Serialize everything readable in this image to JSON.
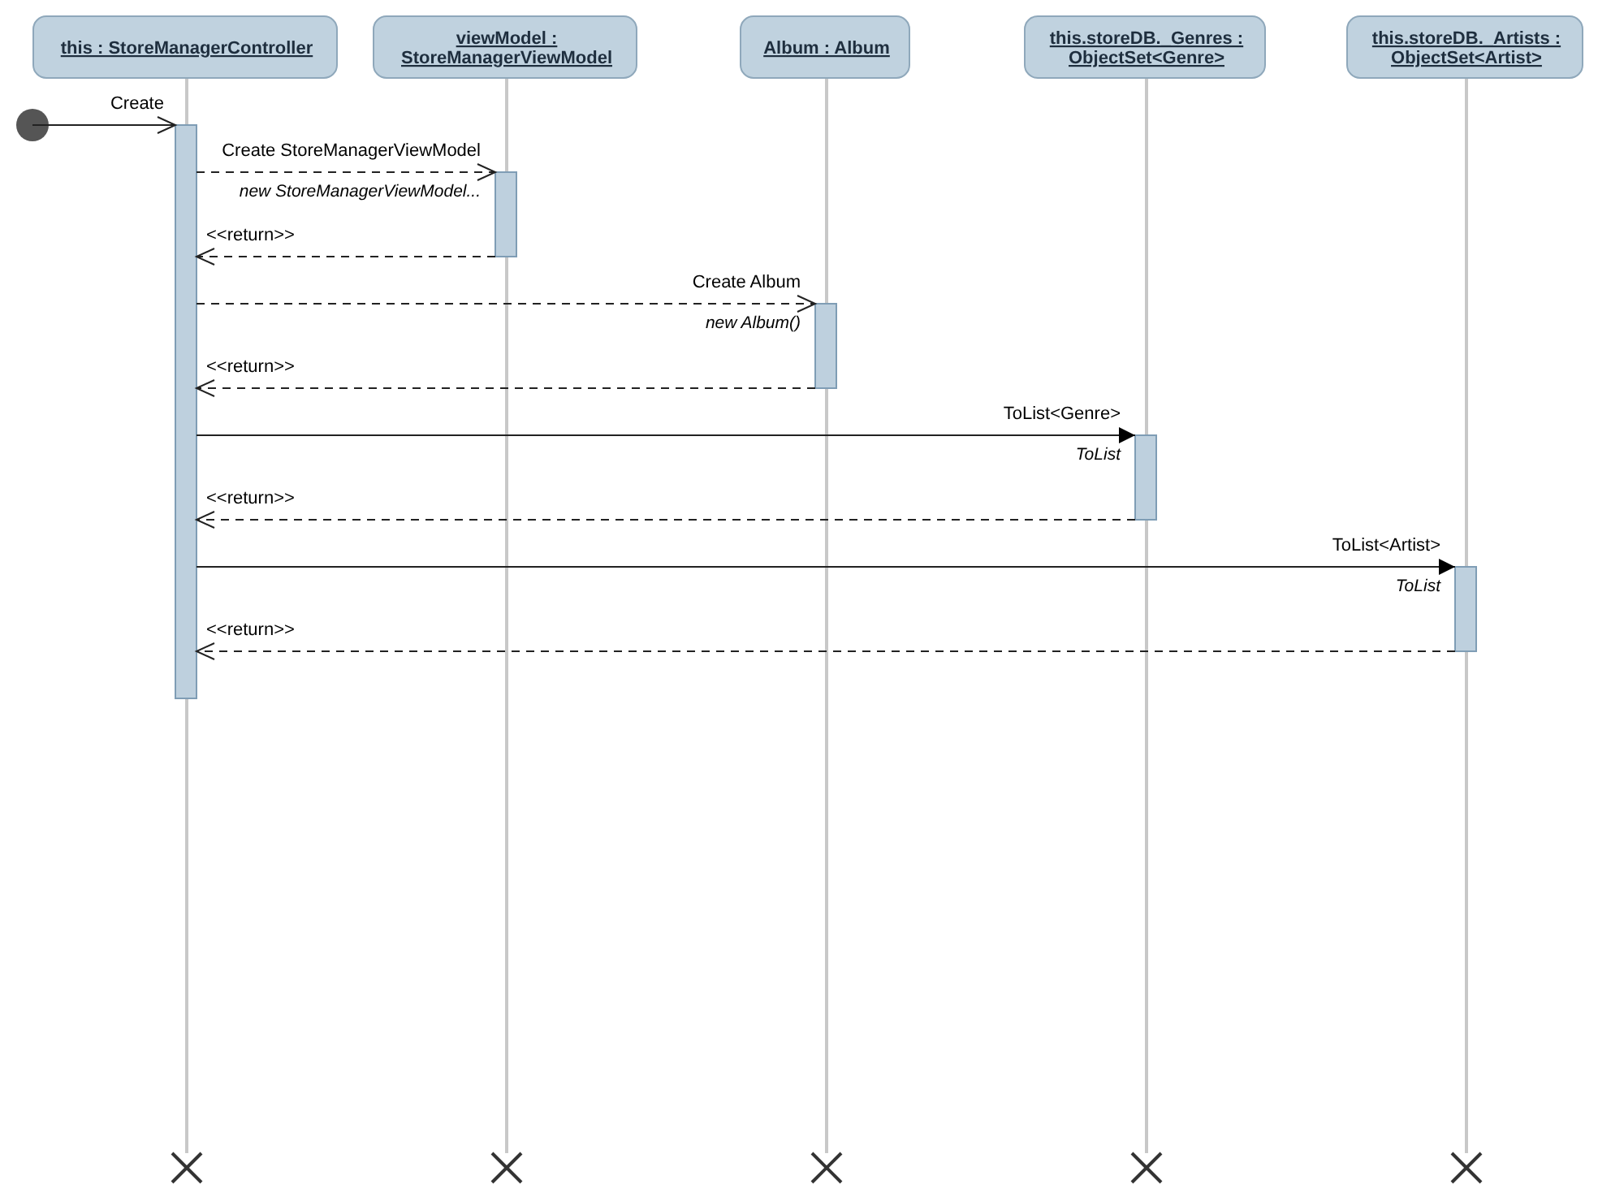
{
  "lifelines": [
    {
      "lines": [
        "this : StoreManagerController"
      ],
      "destroyed": true
    },
    {
      "lines": [
        "viewModel :",
        "StoreManagerViewModel"
      ],
      "destroyed": true
    },
    {
      "lines": [
        "Album : Album"
      ],
      "destroyed": true
    },
    {
      "lines": [
        "this.storeDB._Genres :",
        "ObjectSet<Genre>"
      ],
      "destroyed": true
    },
    {
      "lines": [
        "this.storeDB._Artists :",
        "ObjectSet<Artist>"
      ],
      "destroyed": true
    }
  ],
  "messages": [
    {
      "kind": "found",
      "label": "Create"
    },
    {
      "kind": "create",
      "label": "Create StoreManagerViewModel",
      "note": "new StoreManagerViewModel..."
    },
    {
      "kind": "return",
      "label": "<<return>>"
    },
    {
      "kind": "create",
      "label": "Create Album",
      "note": "new Album()"
    },
    {
      "kind": "return",
      "label": "<<return>>"
    },
    {
      "kind": "sync",
      "label": "ToList<Genre>",
      "note": "ToList"
    },
    {
      "kind": "return",
      "label": "<<return>>"
    },
    {
      "kind": "sync",
      "label": "ToList<Artist>",
      "note": "ToList"
    },
    {
      "kind": "return",
      "label": "<<return>>"
    }
  ]
}
